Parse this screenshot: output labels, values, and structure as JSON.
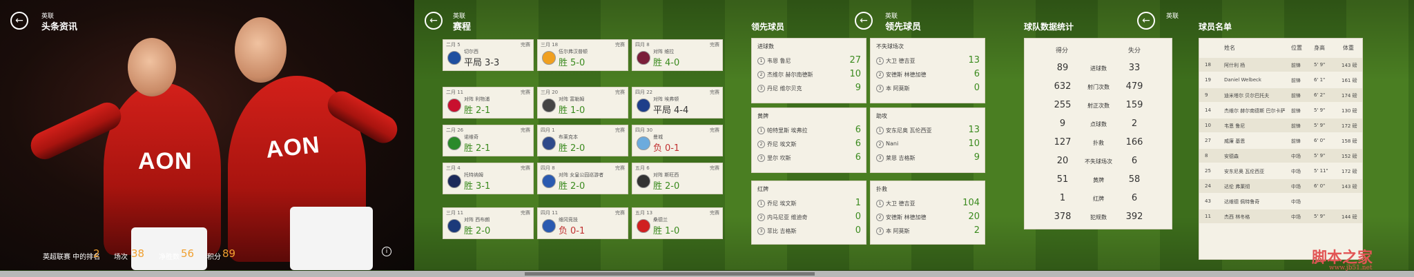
{
  "hero": {
    "league": "英联",
    "title": "头条资讯",
    "jersey_sponsor": "AON",
    "stats": [
      {
        "label": "英超联赛 中的排名",
        "value": "2"
      },
      {
        "label": "场次",
        "value": "38"
      },
      {
        "label": "净胜数",
        "value": "56"
      },
      {
        "label": "积分",
        "value": "89"
      }
    ]
  },
  "schedule": {
    "league": "英联",
    "title": "赛程",
    "matches": [
      {
        "date": "二月 5",
        "status": "完赛",
        "opponent": "切尔西",
        "outcome": "平局",
        "score": "3-3",
        "result": "draw",
        "crest": "#1f4fa0"
      },
      {
        "date": "三月 18",
        "status": "完赛",
        "opponent": "伍尔弗汉普顿",
        "outcome": "胜",
        "score": "5-0",
        "result": "win",
        "crest": "#f0a020"
      },
      {
        "date": "四月 8",
        "status": "完赛",
        "opponent": "对阵 维拉",
        "outcome": "胜",
        "score": "4-0",
        "result": "win",
        "crest": "#7a1e3a"
      },
      {
        "date": "二月 11",
        "status": "完赛",
        "opponent": "对阵 利物浦",
        "outcome": "胜",
        "score": "2-1",
        "result": "win",
        "crest": "#c8102e"
      },
      {
        "date": "三月 20",
        "status": "完赛",
        "opponent": "对阵 富勒姆",
        "outcome": "胜",
        "score": "1-0",
        "result": "win",
        "crest": "#444444"
      },
      {
        "date": "四月 22",
        "status": "完赛",
        "opponent": "对阵 埃弗顿",
        "outcome": "平局",
        "score": "4-4",
        "result": "draw",
        "crest": "#1e3e8a"
      },
      {
        "date": "二月 26",
        "status": "完赛",
        "opponent": "诺维奇",
        "outcome": "胜",
        "score": "2-1",
        "result": "win",
        "crest": "#2a8a2a"
      },
      {
        "date": "四月 1",
        "status": "完赛",
        "opponent": "布莱克本",
        "outcome": "胜",
        "score": "2-0",
        "result": "win",
        "crest": "#2f4a8a"
      },
      {
        "date": "四月 30",
        "status": "完赛",
        "opponent": "曼城",
        "outcome": "负",
        "score": "0-1",
        "result": "loss",
        "crest": "#6cabdd"
      },
      {
        "date": "三月 4",
        "status": "完赛",
        "opponent": "托特纳姆",
        "outcome": "胜",
        "score": "3-1",
        "result": "win",
        "crest": "#1c2a5a"
      },
      {
        "date": "四月 8",
        "status": "完赛",
        "opponent": "对阵 女皇公园巡游者",
        "outcome": "胜",
        "score": "2-0",
        "result": "win",
        "crest": "#2a5ab0"
      },
      {
        "date": "五月 6",
        "status": "完赛",
        "opponent": "对阵 斯旺西",
        "outcome": "胜",
        "score": "2-0",
        "result": "win",
        "crest": "#333333"
      },
      {
        "date": "三月 11",
        "status": "完赛",
        "opponent": "对阵 西布朗",
        "outcome": "胜",
        "score": "2-0",
        "result": "win",
        "crest": "#1c3a7a"
      },
      {
        "date": "四月 11",
        "status": "完赛",
        "opponent": "维冈竞技",
        "outcome": "负",
        "score": "0-1",
        "result": "loss",
        "crest": "#2a5ab0"
      },
      {
        "date": "五月 13",
        "status": "完赛",
        "opponent": "桑德兰",
        "outcome": "胜",
        "score": "1-0",
        "result": "win",
        "crest": "#d02020"
      }
    ]
  },
  "leaders": {
    "title": "领先球员",
    "goals": {
      "title": "进球数",
      "rows": [
        {
          "rank": "1",
          "name": "韦恩 鲁尼",
          "value": "27"
        },
        {
          "rank": "2",
          "name": "杰维尔 赫尔南德斯",
          "value": "10"
        },
        {
          "rank": "3",
          "name": "丹尼 维尔贝克",
          "value": "9"
        }
      ]
    },
    "yellow": {
      "title": "黄牌",
      "rows": [
        {
          "rank": "1",
          "name": "帕特里斯 埃弗拉",
          "value": "6"
        },
        {
          "rank": "2",
          "name": "乔尼 埃文斯",
          "value": "6"
        },
        {
          "rank": "3",
          "name": "里尔 坎斯",
          "value": "6"
        }
      ]
    },
    "red": {
      "title": "红牌",
      "rows": [
        {
          "rank": "1",
          "name": "乔尼 埃文斯",
          "value": "1"
        },
        {
          "rank": "2",
          "name": "内马尼亚 维迪奇",
          "value": "0"
        },
        {
          "rank": "3",
          "name": "菲比 吉格斯",
          "value": "0"
        }
      ]
    }
  },
  "leaders2": {
    "league": "英联",
    "title": "领先球员",
    "saves": {
      "title": "不失球场次",
      "rows": [
        {
          "rank": "1",
          "name": "大卫 德吉亚",
          "value": "13"
        },
        {
          "rank": "2",
          "name": "安德斯 林德加德",
          "value": "6"
        },
        {
          "rank": "3",
          "name": "本 阿莫斯",
          "value": "0"
        }
      ]
    },
    "assists": {
      "title": "助攻",
      "rows": [
        {
          "rank": "1",
          "name": "安东尼奥 瓦伦西亚",
          "value": "13"
        },
        {
          "rank": "2",
          "name": "Nani",
          "value": "10"
        },
        {
          "rank": "3",
          "name": "莱恩 吉格斯",
          "value": "9"
        }
      ]
    },
    "keeper": {
      "title": "扑救",
      "rows": [
        {
          "rank": "1",
          "name": "大卫 德吉亚",
          "value": "104"
        },
        {
          "rank": "2",
          "name": "安德斯 林德加德",
          "value": "20"
        },
        {
          "rank": "3",
          "name": "本 阿莫斯",
          "value": "2"
        }
      ]
    }
  },
  "team_stats": {
    "title": "球队数据统计",
    "col_a": "得分",
    "col_b": "失分",
    "rows": [
      {
        "a": "89",
        "label": "进球数",
        "b": "33"
      },
      {
        "a": "632",
        "label": "射门次数",
        "b": "479"
      },
      {
        "a": "255",
        "label": "射正次数",
        "b": "159"
      },
      {
        "a": "9",
        "label": "点球数",
        "b": "2"
      },
      {
        "a": "127",
        "label": "扑救",
        "b": "166"
      },
      {
        "a": "20",
        "label": "不失球场次",
        "b": "6"
      },
      {
        "a": "51",
        "label": "黄牌",
        "b": "58"
      },
      {
        "a": "1",
        "label": "红牌",
        "b": "6"
      },
      {
        "a": "378",
        "label": "犯规数",
        "b": "392"
      }
    ]
  },
  "roster": {
    "league": "英联",
    "title": "球员名单",
    "columns": [
      "姓名",
      "位置",
      "身高",
      "体重"
    ],
    "rows": [
      {
        "num": "18",
        "name": "阿什利 杨",
        "pos": "前锋",
        "h": "5' 9\"",
        "w": "143 磅"
      },
      {
        "num": "19",
        "name": "Daniel Welbeck",
        "pos": "前锋",
        "h": "6' 1\"",
        "w": "161 磅"
      },
      {
        "num": "9",
        "name": "迪米塔尔 贝尔巴托夫",
        "pos": "前锋",
        "h": "6' 2\"",
        "w": "174 磅"
      },
      {
        "num": "14",
        "name": "杰维尔 赫尔南德斯 巴尔卡萨",
        "pos": "前锋",
        "h": "5' 9\"",
        "w": "130 磅"
      },
      {
        "num": "10",
        "name": "韦恩 鲁尼",
        "pos": "前锋",
        "h": "5' 9\"",
        "w": "172 磅"
      },
      {
        "num": "27",
        "name": "威廉 基恩",
        "pos": "前锋",
        "h": "6' 0\"",
        "w": "158 磅"
      },
      {
        "num": "8",
        "name": "安德森",
        "pos": "中场",
        "h": "5' 9\"",
        "w": "152 磅"
      },
      {
        "num": "25",
        "name": "安东尼奥 瓦伦西亚",
        "pos": "中场",
        "h": "5' 11\"",
        "w": "172 磅"
      },
      {
        "num": "24",
        "name": "达伦 弗莱彻",
        "pos": "中场",
        "h": "6' 0\"",
        "w": "143 磅"
      },
      {
        "num": "43",
        "name": "达维德 佩特鲁奇",
        "pos": "中场",
        "h": "",
        "w": ""
      },
      {
        "num": "11",
        "name": "杰西 林冬格",
        "pos": "中场",
        "h": "5' 9\"",
        "w": "144 磅"
      }
    ]
  },
  "footer": {
    "info_icon": "i"
  },
  "watermark": {
    "line1": "脚本之家",
    "line2": "www.jb51.net"
  }
}
